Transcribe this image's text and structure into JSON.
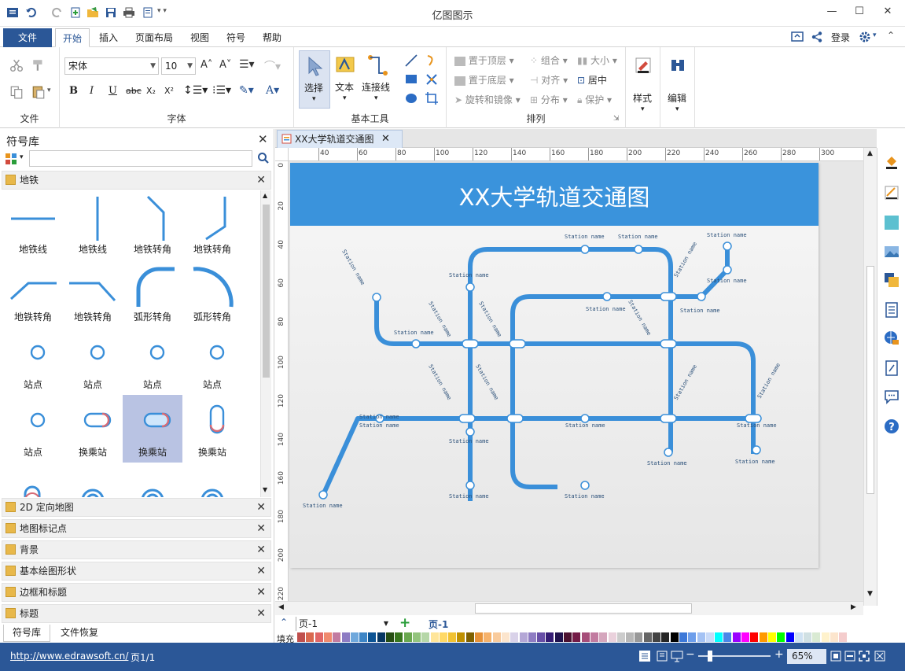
{
  "app": {
    "title": "亿图图示"
  },
  "menu": {
    "file": "文件",
    "tabs": [
      "开始",
      "插入",
      "页面布局",
      "视图",
      "符号",
      "帮助"
    ],
    "login": "登录"
  },
  "ribbon": {
    "groups": {
      "file": "文件",
      "font": "字体",
      "basic_tools": "基本工具",
      "arrange": "排列"
    },
    "font_name": "宋体",
    "font_size": "10",
    "tools": {
      "select": "选择",
      "text": "文本",
      "connector": "连接线"
    },
    "arrange": {
      "bring_front": "置于顶层",
      "send_back": "置于底层",
      "rotate": "旋转和镜像",
      "group": "组合",
      "align": "对齐",
      "distribute": "分布",
      "size": "大小",
      "center": "居中",
      "protect": "保护"
    },
    "style": "样式",
    "edit": "编辑"
  },
  "library": {
    "title": "符号库",
    "search_placeholder": "",
    "active_section": "地铁",
    "shapes": [
      "地铁线",
      "地铁线",
      "地铁转角",
      "地铁转角",
      "地铁转角",
      "地铁转角",
      "弧形转角",
      "弧形转角",
      "站点",
      "站点",
      "站点",
      "站点",
      "站点",
      "换乘站",
      "换乘站",
      "换乘站"
    ],
    "sections": [
      "2D 定向地图",
      "地图标记点",
      "背景",
      "基本绘图形状",
      "边框和标题",
      "标题"
    ],
    "bottom_tabs": [
      "符号库",
      "文件恢复"
    ]
  },
  "document": {
    "tab_title": "XX大学轨道交通图",
    "diagram_title": "XX大学轨道交通图",
    "station_label": "Station name",
    "ruler_top": [
      "40",
      "60",
      "80",
      "100",
      "120",
      "140",
      "160",
      "180",
      "200",
      "220",
      "240",
      "260",
      "280",
      "300"
    ],
    "ruler_left": [
      "0",
      "20",
      "40",
      "60",
      "80",
      "100",
      "120",
      "140",
      "160",
      "180",
      "200",
      "220"
    ]
  },
  "pagebar": {
    "page_select": "页-1",
    "page_tab": "页-1",
    "fill_label": "填充"
  },
  "status": {
    "url": "http://www.edrawsoft.cn/",
    "page": "页1/1",
    "zoom": "65%"
  },
  "colors": {
    "accent": "#2b5797",
    "metro": "#3a8fd9",
    "palette": [
      "#c0504d",
      "#d9694f",
      "#e06666",
      "#f08a6e",
      "#c27ba0",
      "#8e7cc3",
      "#6fa8dc",
      "#3d85c6",
      "#0b5394",
      "#073763",
      "#274e13",
      "#38761d",
      "#6aa84f",
      "#93c47d",
      "#b6d7a8",
      "#ffe599",
      "#ffd966",
      "#f1c232",
      "#bf9000",
      "#7f6000",
      "#e69138",
      "#f6b26b",
      "#f9cb9c",
      "#fce5cd",
      "#d9d2e9",
      "#b4a7d6",
      "#8e7cc3",
      "#674ea7",
      "#351c75",
      "#20124d",
      "#4c1130",
      "#741b47",
      "#a64d79",
      "#c27ba0",
      "#d5a6bd",
      "#ead1dc",
      "#cccccc",
      "#b7b7b7",
      "#999999",
      "#666666",
      "#434343",
      "#262626",
      "#000000",
      "#3c78d8",
      "#6d9eeb",
      "#a4c2f4",
      "#c9daf8",
      "#00ffff",
      "#4a86e8",
      "#9900ff",
      "#ff00ff",
      "#ff0000",
      "#ff9900",
      "#ffff00",
      "#00ff00",
      "#0000ff",
      "#cfe2f3",
      "#d0e0e3",
      "#d9ead3",
      "#fff2cc",
      "#fce5cd",
      "#f4cccc"
    ]
  }
}
